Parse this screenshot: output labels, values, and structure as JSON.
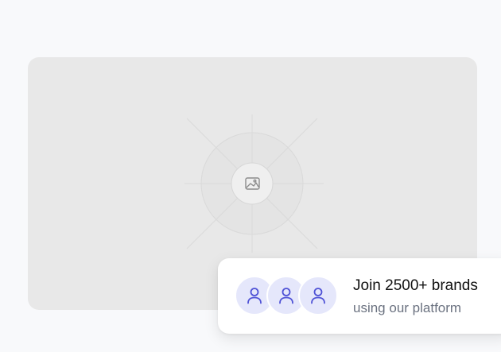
{
  "hero": {
    "image_icon": "image-icon"
  },
  "social_proof": {
    "avatars": [
      {
        "icon": "user-icon"
      },
      {
        "icon": "user-icon"
      },
      {
        "icon": "user-icon"
      }
    ],
    "title": "Join 2500+ brands",
    "subtitle": "using our platform"
  },
  "colors": {
    "background": "#f8f9fb",
    "placeholder": "#e8e8e8",
    "avatar_bg": "#e5e7fb",
    "avatar_icon": "#4f52d6",
    "title_text": "#111111",
    "subtitle_text": "#6b7280"
  }
}
